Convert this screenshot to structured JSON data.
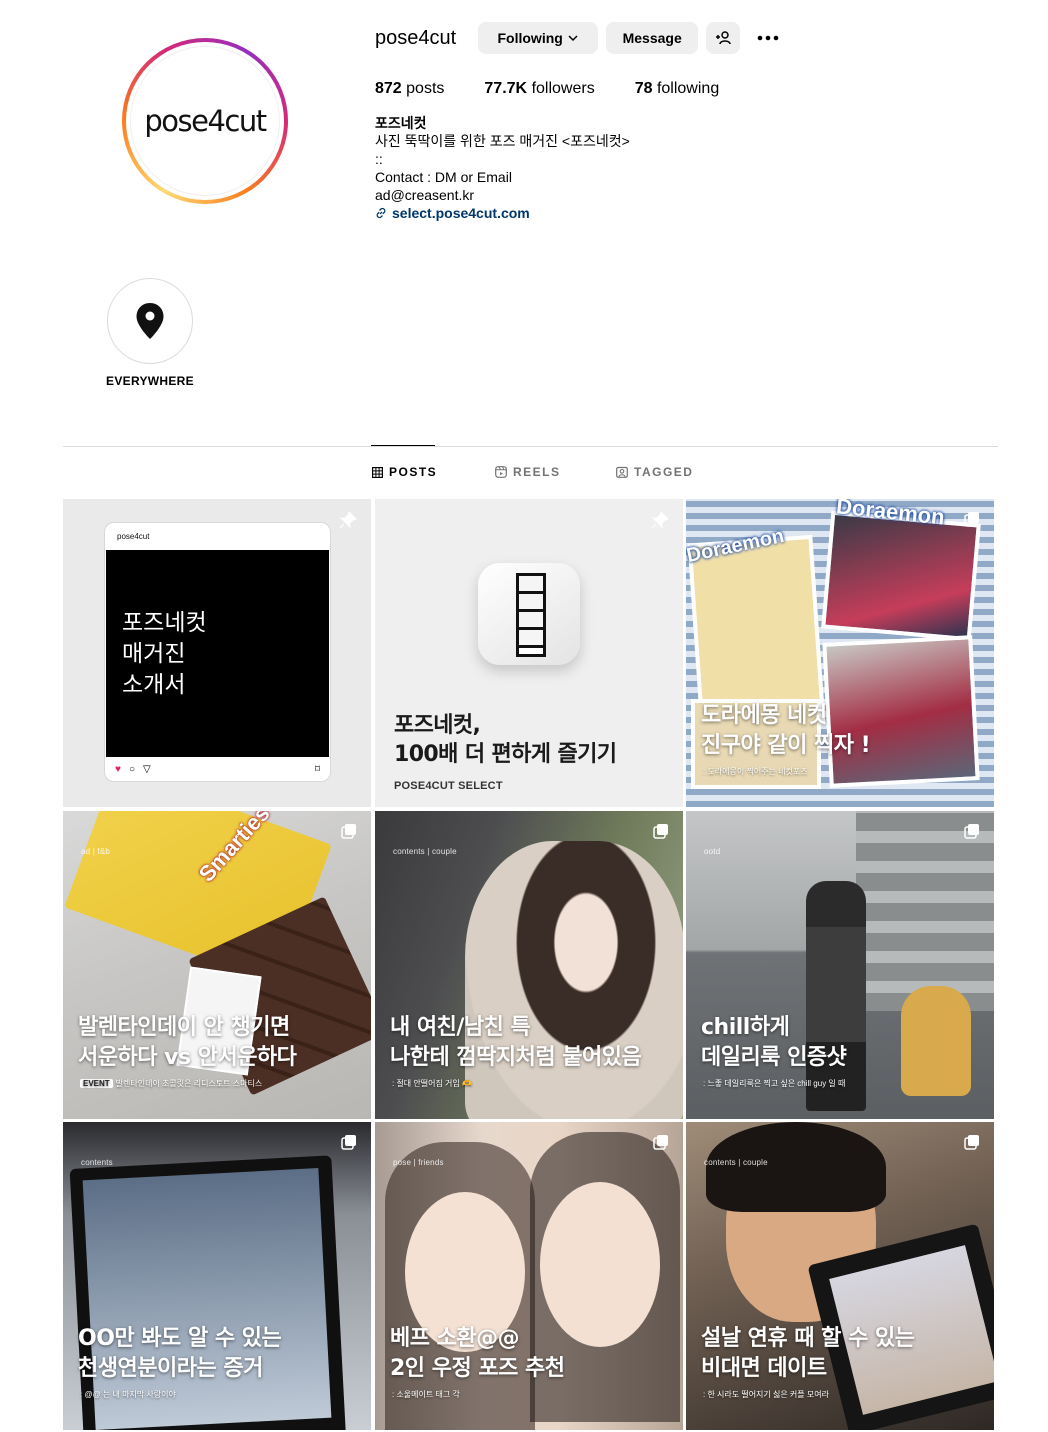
{
  "profile": {
    "avatar_text": "pose4cut",
    "username": "pose4cut",
    "buttons": {
      "following": "Following",
      "message": "Message"
    },
    "stats": {
      "posts_count": "872",
      "posts_label": "posts",
      "followers_count": "77.7K",
      "followers_label": "followers",
      "following_count": "78",
      "following_label": "following"
    },
    "bio": {
      "full_name": "포즈네컷",
      "line1": "사진 뚝딱이를 위한 포즈 매거진 <포즈네컷>",
      "line2": "::",
      "line3": "Contact : DM or Email",
      "line4": "ad@creasent.kr",
      "link": "select.pose4cut.com"
    }
  },
  "highlights": [
    {
      "label": "EVERYWHERE",
      "icon": "location-pin-icon"
    }
  ],
  "tabs": [
    {
      "label": "POSTS",
      "icon": "grid-icon",
      "active": true
    },
    {
      "label": "REELS",
      "icon": "reels-icon",
      "active": false
    },
    {
      "label": "TAGGED",
      "icon": "tagged-icon",
      "active": false
    }
  ],
  "posts": [
    {
      "brand": "pose4cut",
      "title_line1": "포즈네컷",
      "title_line2": "매거진",
      "title_line3": "소개서",
      "pinned": true
    },
    {
      "title_line1": "포즈네컷,",
      "title_line2": "100배 더 편하게 즐기기",
      "subtitle": "POSE4CUT SELECT",
      "pinned": true
    },
    {
      "logo_main": "Doraemon",
      "logo_small": "Doraemon",
      "title_line1": "도라에몽 네컷",
      "title_line2": "진구야 같이 찍자 !",
      "subtitle": ": 도라에몽이 찍어주는 네컷포즈"
    },
    {
      "tag": "ad | f&b",
      "logo": "Smarties",
      "title_line1": "발렌타인데이 안 챙기면",
      "title_line2": "서운하다 vs 안서운하다",
      "badge": "EVENT",
      "subtitle": "발렌타인데이 초콜릿은 리디스토트 스마티스"
    },
    {
      "tag": "contents | couple",
      "title_line1": "내 여친/남친 특",
      "title_line2": "나한테 껌딱지처럼 붙어있음",
      "subtitle": ": 절대 안떨어짐 거임 🫶"
    },
    {
      "tag": "ootd",
      "title_line1": "chill하게",
      "title_line2": "데일리룩 인증샷",
      "subtitle": ": 느좋 데일리룩은 찍고 싶은 chill guy 일 때"
    },
    {
      "tag": "contents",
      "title_line1": "OO만 봐도 알 수 있는",
      "title_line2": "천생연분이라는 증거",
      "subtitle": ": @@ 는 내 마지막 사랑이야"
    },
    {
      "tag": "pose | friends",
      "title_line1": "베프 소환@@",
      "title_line2": "2인 우정 포즈 추천",
      "subtitle": ": 소울메이트 태그 각"
    },
    {
      "tag": "contents | couple",
      "title_line1": "설날 연휴 때 할 수 있는",
      "title_line2": "비대면 데이트",
      "subtitle": ": 한 시라도 떨어지기 싫은 커플 모여라"
    }
  ]
}
